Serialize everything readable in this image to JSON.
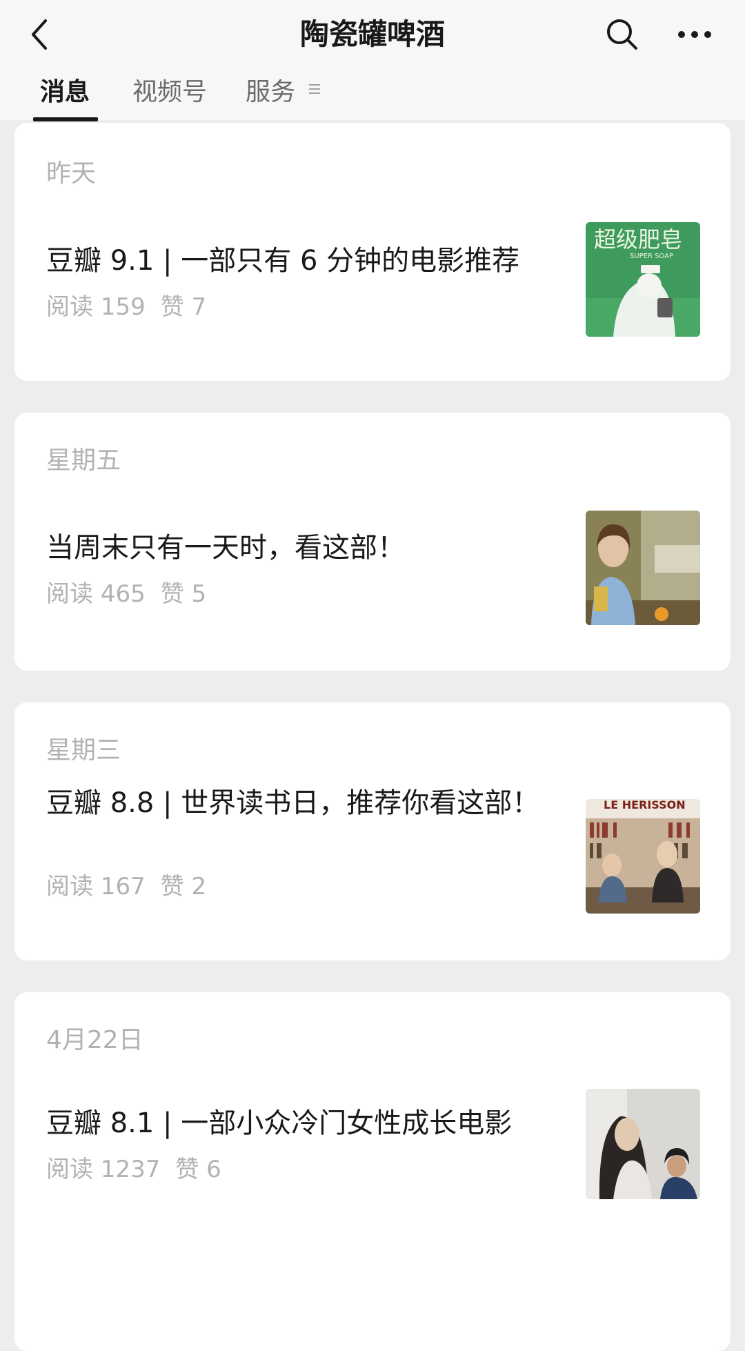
{
  "header": {
    "title": "陶瓷罐啤酒"
  },
  "tabs": [
    {
      "label": "消息",
      "active": true
    },
    {
      "label": "视频号",
      "active": false
    },
    {
      "label": "服务",
      "active": false
    }
  ],
  "articles": [
    {
      "date": "昨天",
      "title": "豆瓣 9.1 | 一部只有 6 分钟的电影推荐",
      "reads": "阅读 159",
      "likes": "赞 7",
      "thumb_text": "超级肥皂",
      "thumb_subtext": "SUPER SOAP"
    },
    {
      "date": "星期五",
      "title": "当周末只有一天时，看这部！",
      "reads": "阅读 465",
      "likes": "赞 5"
    },
    {
      "date": "星期三",
      "title": "豆瓣 8.8 | 世界读书日，推荐你看这部！",
      "reads": "阅读 167",
      "likes": "赞 2",
      "thumb_text": "LE HERISSON"
    },
    {
      "date": "4月22日",
      "title": "豆瓣 8.1 | 一部小众冷门女性成长电影",
      "reads": "阅读 1237",
      "likes": "赞 6"
    }
  ]
}
